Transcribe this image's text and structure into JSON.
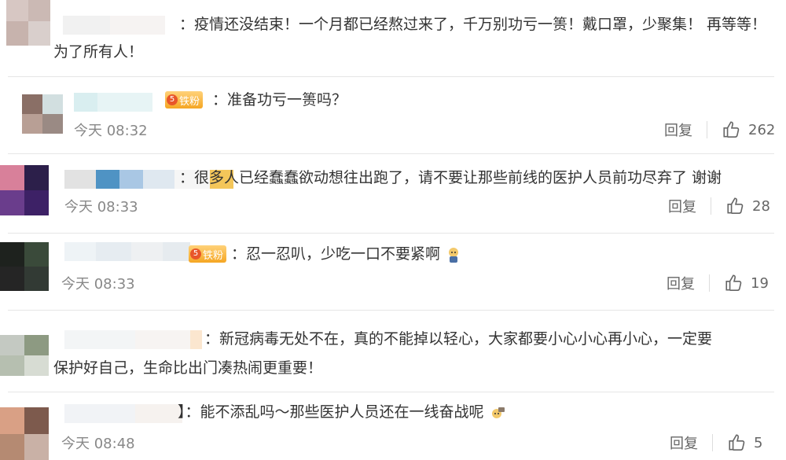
{
  "comments": [
    {
      "text_line1": "：疫情还没结束！一个月都已经熬过来了，千万别功亏一篑！戴口罩，少聚集！ 再等等！",
      "text_line2": "为了所有人！",
      "time": "",
      "reply_label": "",
      "likes": ""
    },
    {
      "badge": "铁粉",
      "badge_level": "5",
      "text_line1": "：准备功亏一篑吗？",
      "time": "今天 08:32",
      "reply_label": "回复",
      "likes": "262"
    },
    {
      "text_line1": "：很多人已经蠢蠢欲动想往出跑了，请不要让那些前线的医护人员前功尽弃了 谢谢",
      "time": "今天 08:33",
      "reply_label": "回复",
      "likes": "28"
    },
    {
      "badge": "铁粉",
      "badge_level": "5",
      "text_line1": "：忍一忍叭，少吃一口不要紧啊",
      "time": "今天 08:33",
      "reply_label": "回复",
      "likes": "19"
    },
    {
      "text_line1": "：新冠病毒无处不在，真的不能掉以轻心，大家都要小心小心再小心，一定要",
      "text_line2": "保护好自己，生命比出门凑热闹更重要！",
      "time": "",
      "reply_label": "",
      "likes": ""
    },
    {
      "text_line1": "】：能不添乱吗～那些医护人员还在一线奋战呢",
      "time": "今天 08:48",
      "reply_label": "回复",
      "likes": "5"
    }
  ],
  "icons": {
    "like": "thumbs-up-icon",
    "emoji_sweat": "sweat-face-emoji",
    "emoji_fight": "fighting-emoji"
  },
  "colors": {
    "text": "#333333",
    "muted": "#888888",
    "badge": "#f5a623"
  }
}
